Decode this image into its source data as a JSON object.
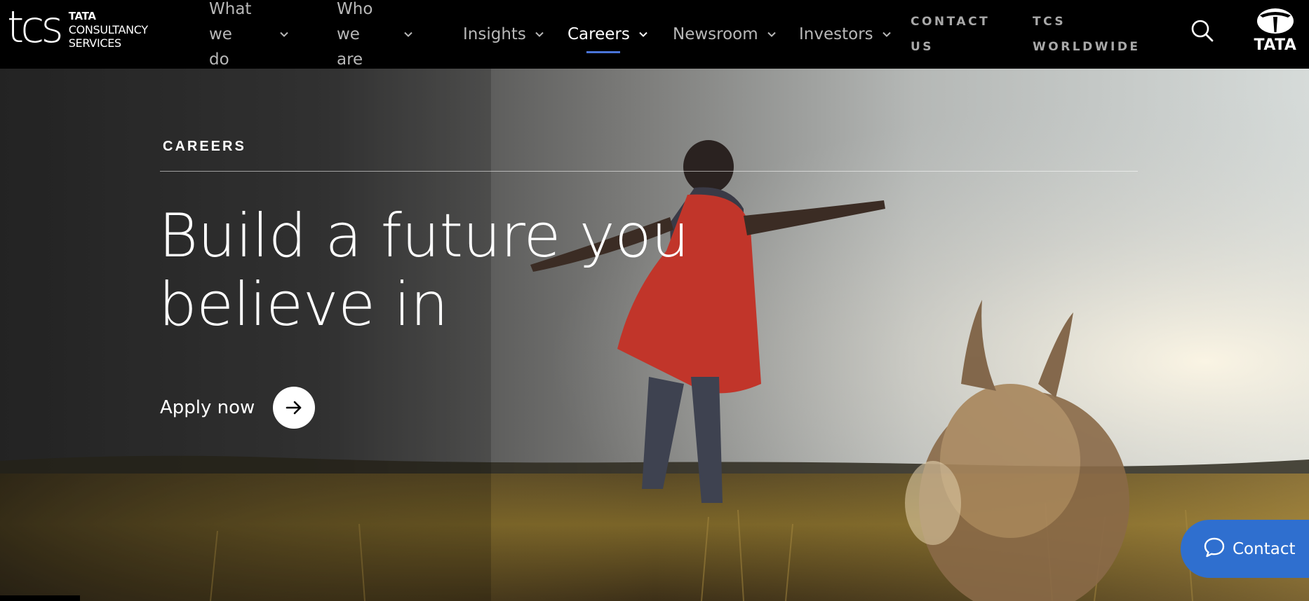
{
  "brand": {
    "mark": "tcs",
    "line1": "TATA",
    "line2": "CONSULTANCY",
    "line3": "SERVICES",
    "group_name": "TATA"
  },
  "nav": {
    "items": [
      {
        "label_line1": "What we",
        "label_line2": "do",
        "icon": "chevron-down-icon"
      },
      {
        "label_line1": "Who we",
        "label_line2": "are",
        "icon": "chevron-down-icon"
      },
      {
        "label": "Insights",
        "icon": "chevron-down-icon"
      },
      {
        "label": "Careers",
        "icon": "chevron-down-icon",
        "active": true
      },
      {
        "label": "Newsroom",
        "icon": "chevron-down-icon"
      },
      {
        "label": "Investors",
        "icon": "chevron-down-icon"
      }
    ],
    "contact_line1": "CONTACT",
    "contact_line2": "US",
    "worldwide_line1": "TCS",
    "worldwide_line2": "WORLDWIDE",
    "search_icon": "search-icon"
  },
  "hero": {
    "eyebrow": "CAREERS",
    "headline_line1": "Build a future you",
    "headline_line2": "believe in",
    "cta_label": "Apply now",
    "cta_icon": "arrow-right-icon"
  },
  "contact_fab": {
    "label": "Contact",
    "icon": "chat-bubble-icon"
  },
  "colors": {
    "accent": "#4a74d8",
    "fab": "#2f6fcf",
    "header_bg": "#000000"
  }
}
